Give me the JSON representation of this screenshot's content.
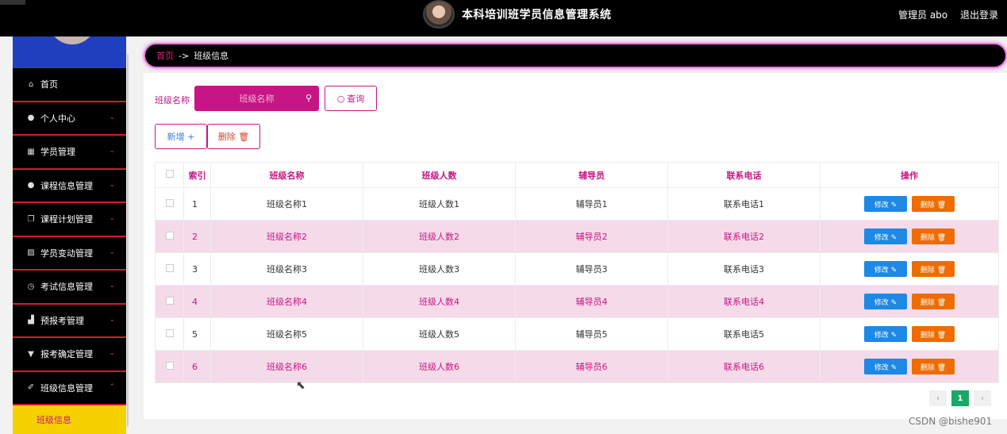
{
  "header": {
    "title": "本科培训班学员信息管理系统",
    "admin": "管理员 abo",
    "logout": "退出登录"
  },
  "sidebar": {
    "items": [
      {
        "label": "首页",
        "icon": "home-icon",
        "glyph": "⌂"
      },
      {
        "label": "个人中心",
        "icon": "user-icon",
        "glyph": "●",
        "chevron": "⌄"
      },
      {
        "label": "学员管理",
        "icon": "grid-icon",
        "glyph": "▦",
        "chevron": "⌄"
      },
      {
        "label": "课程信息管理",
        "icon": "user-icon",
        "glyph": "●",
        "chevron": "⌄"
      },
      {
        "label": "课程计划管理",
        "icon": "copy-icon",
        "glyph": "❐",
        "chevron": "⌄"
      },
      {
        "label": "学员变动管理",
        "icon": "chart-icon",
        "glyph": "▨",
        "chevron": "⌄"
      },
      {
        "label": "考试信息管理",
        "icon": "compass-icon",
        "glyph": "◷",
        "chevron": "⌄"
      },
      {
        "label": "预报考管理",
        "icon": "thumb-icon",
        "glyph": "▟",
        "chevron": "⌄"
      },
      {
        "label": "报考确定管理",
        "icon": "trophy-icon",
        "glyph": "▼",
        "chevron": "⌄"
      },
      {
        "label": "班级信息管理",
        "icon": "pen-icon",
        "glyph": "✐",
        "chevron": "⌃"
      }
    ],
    "submenu": "班级信息"
  },
  "breadcrumb": {
    "home": "首页",
    "sep": "->",
    "current": "班级信息"
  },
  "search": {
    "label": "班级名称",
    "placeholder": "班级名称",
    "query_button": "查询"
  },
  "actions": {
    "add": "新增 +",
    "delete": "删除 🗑"
  },
  "table": {
    "headers": [
      "索引",
      "班级名称",
      "班级人数",
      "辅导员",
      "联系电话",
      "操作"
    ],
    "rows": [
      [
        "1",
        "班级名称1",
        "班级人数1",
        "辅导员1",
        "联系电话1"
      ],
      [
        "2",
        "班级名称2",
        "班级人数2",
        "辅导员2",
        "联系电话2"
      ],
      [
        "3",
        "班级名称3",
        "班级人数3",
        "辅导员3",
        "联系电话3"
      ],
      [
        "4",
        "班级名称4",
        "班级人数4",
        "辅导员4",
        "联系电话4"
      ],
      [
        "5",
        "班级名称5",
        "班级人数5",
        "辅导员5",
        "联系电话5"
      ],
      [
        "6",
        "班级名称6",
        "班级人数6",
        "辅导员6",
        "联系电话6"
      ]
    ],
    "edit_label": "修改 ✎",
    "delete_label": "删除 🗑"
  },
  "pager": {
    "prev": "‹",
    "current": "1",
    "next": "›"
  },
  "watermark": "CSDN @bishe901",
  "colors": {
    "accent": "#c71585",
    "edit": "#1e88e5",
    "delete": "#ef6c00",
    "pager_active": "#1aa867"
  }
}
